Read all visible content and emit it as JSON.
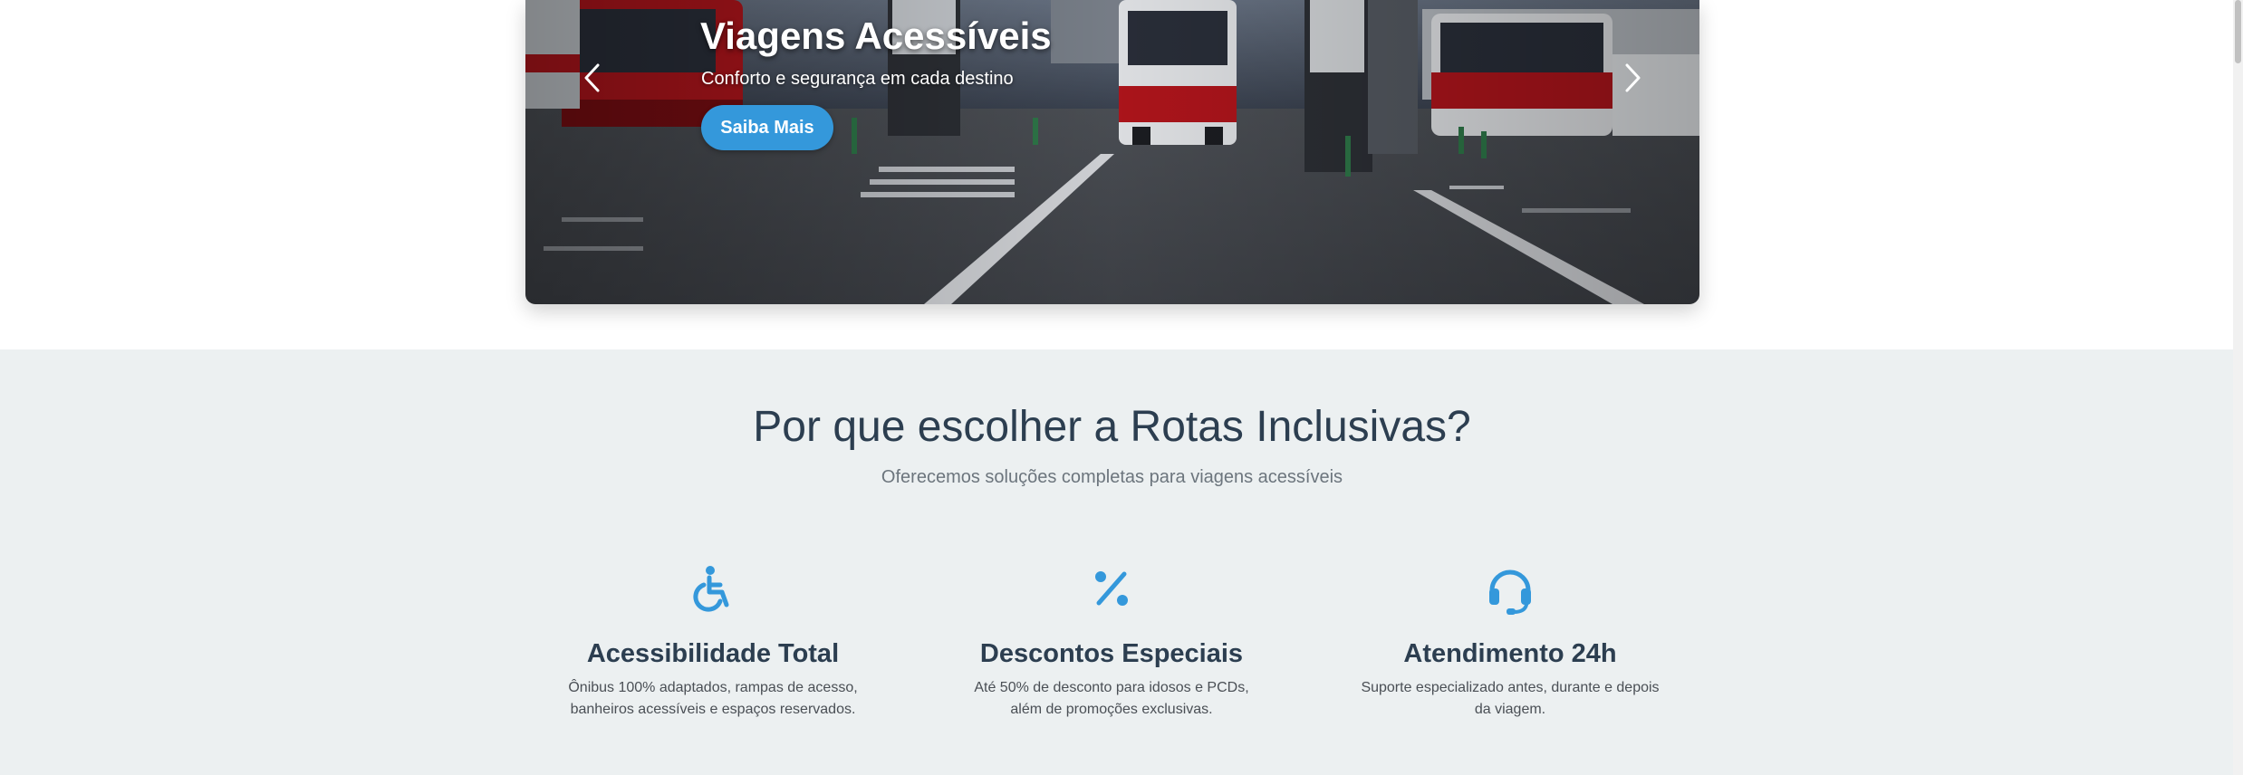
{
  "colors": {
    "accent": "#3498db",
    "features_background": "#ecf0f1",
    "heading": "#2c3e50",
    "muted_text": "#6c757d"
  },
  "hero": {
    "title": "Viagens Acessíveis",
    "subtitle": "Conforto e segurança em cada destino",
    "button_label": "Saiba Mais",
    "prev_icon": "chevron-left-icon",
    "next_icon": "chevron-right-icon"
  },
  "features": {
    "title": "Por que escolher a Rotas Inclusivas?",
    "subtitle": "Oferecemos soluções completas para viagens acessíveis",
    "items": [
      {
        "icon": "wheelchair-icon",
        "title": "Acessibilidade Total",
        "text": "Ônibus 100% adaptados, rampas de acesso, banheiros acessíveis e espaços reservados."
      },
      {
        "icon": "percent-icon",
        "title": "Descontos Especiais",
        "text": "Até 50% de desconto para idosos e PCDs, além de promoções exclusivas."
      },
      {
        "icon": "headset-icon",
        "title": "Atendimento 24h",
        "text": "Suporte especializado antes, durante e depois da viagem."
      }
    ]
  }
}
